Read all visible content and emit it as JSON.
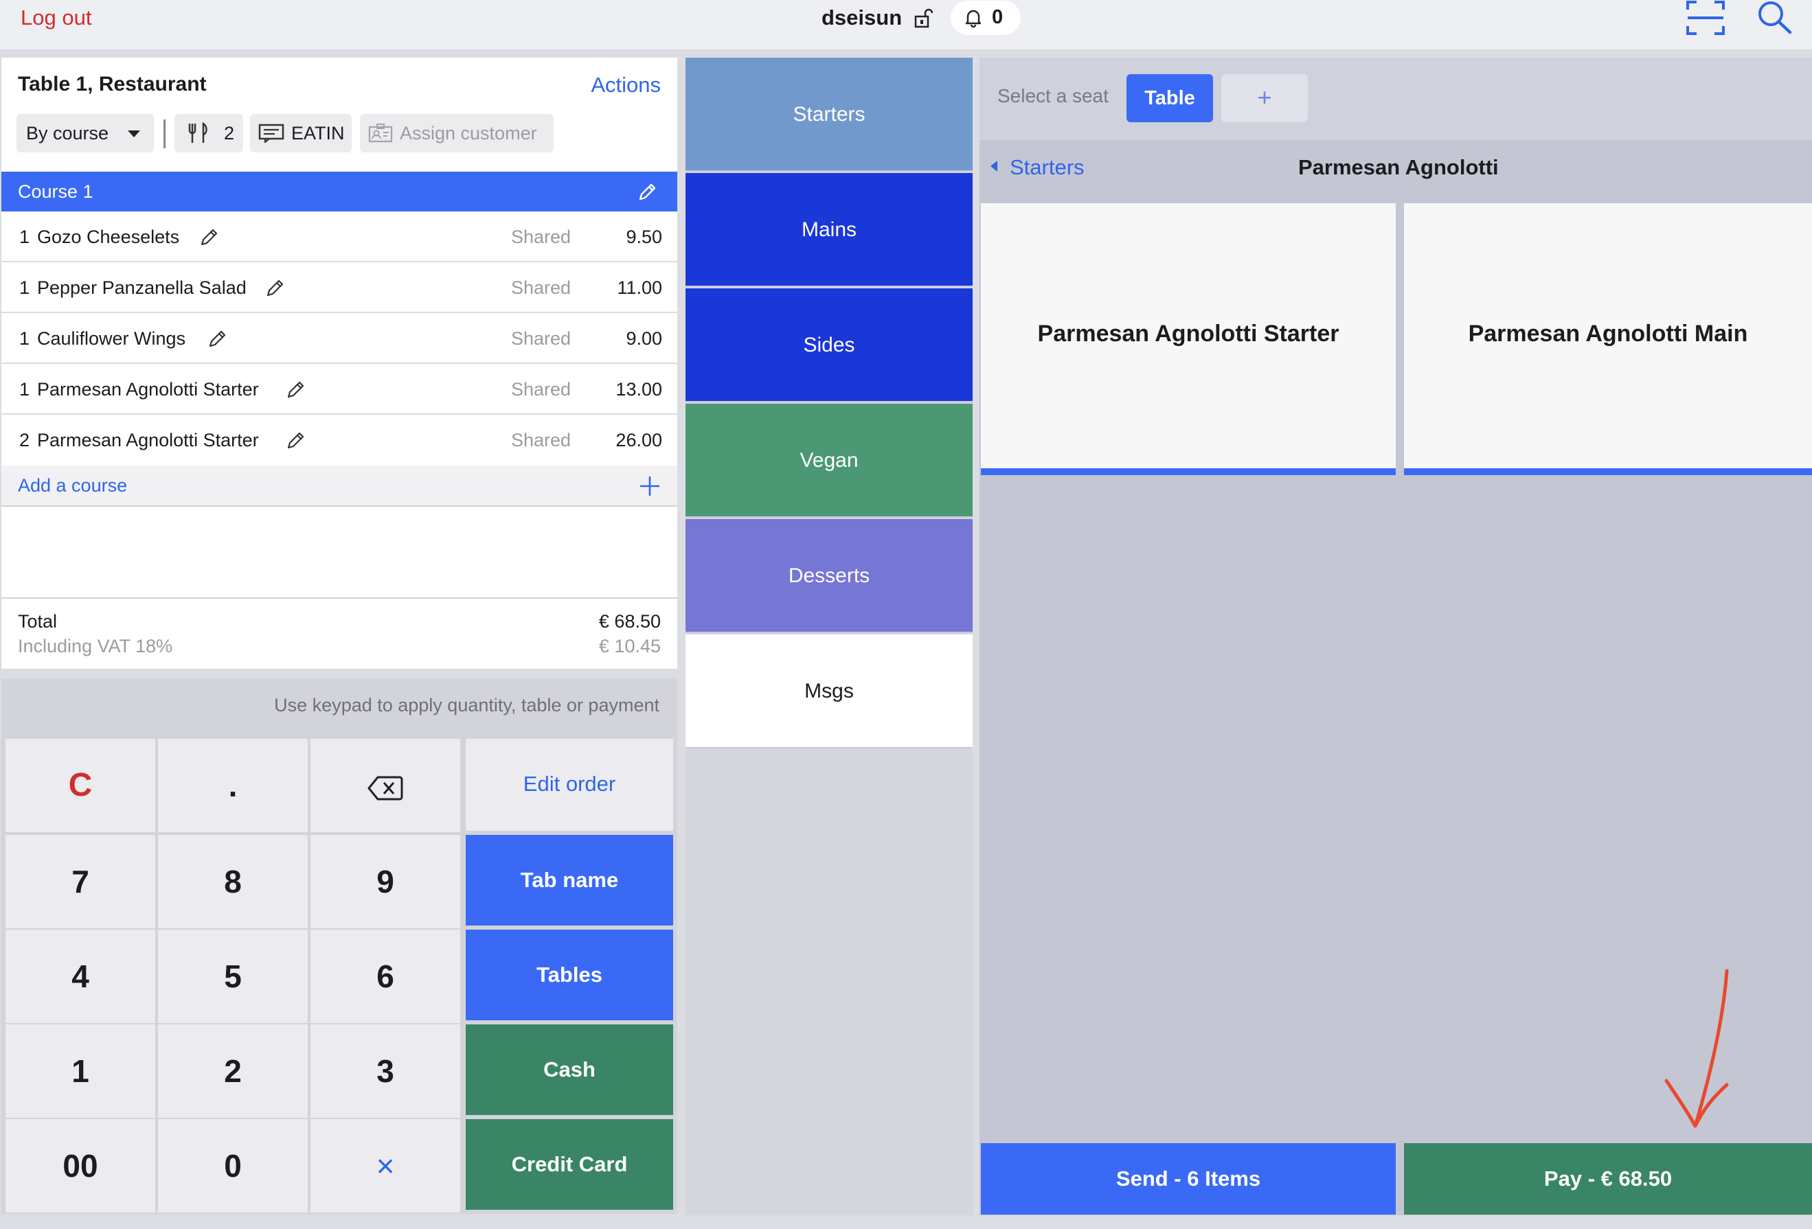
{
  "topbar": {
    "logout_label": "Log out",
    "username": "dseisun",
    "notification_count": "0"
  },
  "order": {
    "title": "Table 1, Restaurant",
    "actions_label": "Actions",
    "view_mode": "By course",
    "covers": "2",
    "order_type": "EATIN",
    "assign_customer_label": "Assign customer",
    "course_label": "Course 1",
    "items": [
      {
        "qty": "1",
        "name": "Gozo Cheeselets",
        "seat": "Shared",
        "price": "9.50"
      },
      {
        "qty": "1",
        "name": "Pepper Panzanella Salad",
        "seat": "Shared",
        "price": "11.00"
      },
      {
        "qty": "1",
        "name": "Cauliflower Wings",
        "seat": "Shared",
        "price": "9.00"
      },
      {
        "qty": "1",
        "name": "Parmesan Agnolotti Starter",
        "seat": "Shared",
        "price": "13.00"
      },
      {
        "qty": "2",
        "name": "Parmesan Agnolotti Starter",
        "seat": "Shared",
        "price": "26.00"
      }
    ],
    "add_course_label": "Add a course",
    "total_label": "Total",
    "total_value": "€ 68.50",
    "vat_label": "Including VAT 18%",
    "vat_value": "€ 10.45"
  },
  "keypad": {
    "hint": "Use keypad to apply quantity, table or payment",
    "keys": [
      "C",
      ".",
      "⌫",
      "7",
      "8",
      "9",
      "4",
      "5",
      "6",
      "1",
      "2",
      "3",
      "00",
      "0",
      "×"
    ],
    "edit_order_label": "Edit order",
    "tab_name_label": "Tab name",
    "tables_label": "Tables",
    "cash_label": "Cash",
    "credit_card_label": "Credit Card"
  },
  "categories": [
    {
      "label": "Starters",
      "color": "#7199cc"
    },
    {
      "label": "Mains",
      "color": "#1a37d8"
    },
    {
      "label": "Sides",
      "color": "#1a37d8"
    },
    {
      "label": "Vegan",
      "color": "#4c9874"
    },
    {
      "label": "Desserts",
      "color": "#7676d4"
    },
    {
      "label": "Msgs",
      "color": "#ffffff"
    }
  ],
  "products": {
    "seat_prompt": "Select a seat",
    "seat_table_label": "Table",
    "seat_add_label": "+",
    "back_label": "Starters",
    "title": "Parmesan Agnolotti",
    "cards": [
      "Parmesan Agnolotti Starter",
      "Parmesan Agnolotti Main"
    ],
    "send_label": "Send - 6 Items",
    "pay_label": "Pay - € 68.50"
  },
  "colors": {
    "accent_blue": "#3a6af5",
    "pay_green": "#3a8566",
    "logout_red": "#d12e2e",
    "annotation_arrow": "#e8492f"
  }
}
